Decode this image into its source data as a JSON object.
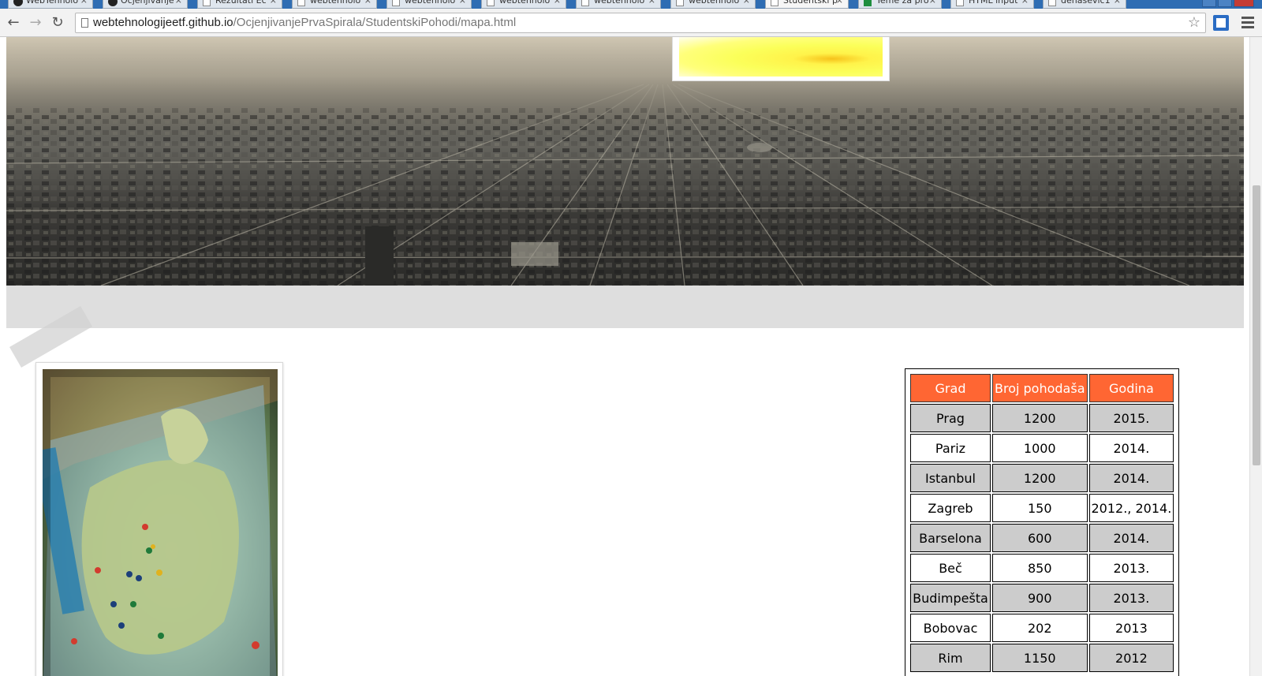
{
  "browser": {
    "tabs": [
      {
        "title": "WebTehnolo",
        "icon": "github-icon"
      },
      {
        "title": "Ocjenjivanje",
        "icon": "github-icon"
      },
      {
        "title": "Rezultati Ec",
        "icon": "page-icon"
      },
      {
        "title": "webtehnolo",
        "icon": "page-icon"
      },
      {
        "title": "webtehnolo",
        "icon": "page-icon"
      },
      {
        "title": "webtehnolo",
        "icon": "page-icon"
      },
      {
        "title": "webtehnolo",
        "icon": "page-icon"
      },
      {
        "title": "webtehnolo",
        "icon": "page-icon"
      },
      {
        "title": "Studentski p",
        "icon": "page-icon",
        "active": true
      },
      {
        "title": "Teme za pro",
        "icon": "sheets-icon"
      },
      {
        "title": "HTML input",
        "icon": "page-icon"
      },
      {
        "title": "dehasevic1",
        "icon": "page-icon"
      }
    ],
    "url_host": "webtehnologijeetf.github.io",
    "url_path": "/OcjenjivanjePrvaSpirala/StudentskiPohodi/mapa.html",
    "back_icon": "←",
    "forward_icon": "→",
    "reload_icon": "↻",
    "star_icon": "☆",
    "tab_close_glyph": "×"
  },
  "table": {
    "headers": [
      "Grad",
      "Broj pohodaša",
      "Godina"
    ],
    "rows": [
      {
        "grad": "Prag",
        "broj": "1200",
        "godina": "2015."
      },
      {
        "grad": "Pariz",
        "broj": "1000",
        "godina": "2014."
      },
      {
        "grad": "Istanbul",
        "broj": "1200",
        "godina": "2014."
      },
      {
        "grad": "Zagreb",
        "broj": "150",
        "godina": "2012., 2014."
      },
      {
        "grad": "Barselona",
        "broj": "600",
        "godina": "2014."
      },
      {
        "grad": "Beč",
        "broj": "850",
        "godina": "2013."
      },
      {
        "grad": "Budimpešta",
        "broj": "900",
        "godina": "2013."
      },
      {
        "grad": "Bobovac",
        "broj": "202",
        "godina": "2013"
      },
      {
        "grad": "Rim",
        "broj": "1150",
        "godina": "2012"
      }
    ]
  },
  "colors": {
    "header_bg": "#ff6633",
    "odd_row_bg": "#cccccc",
    "even_row_bg": "#ffffff",
    "nav_band": "#dedede"
  }
}
